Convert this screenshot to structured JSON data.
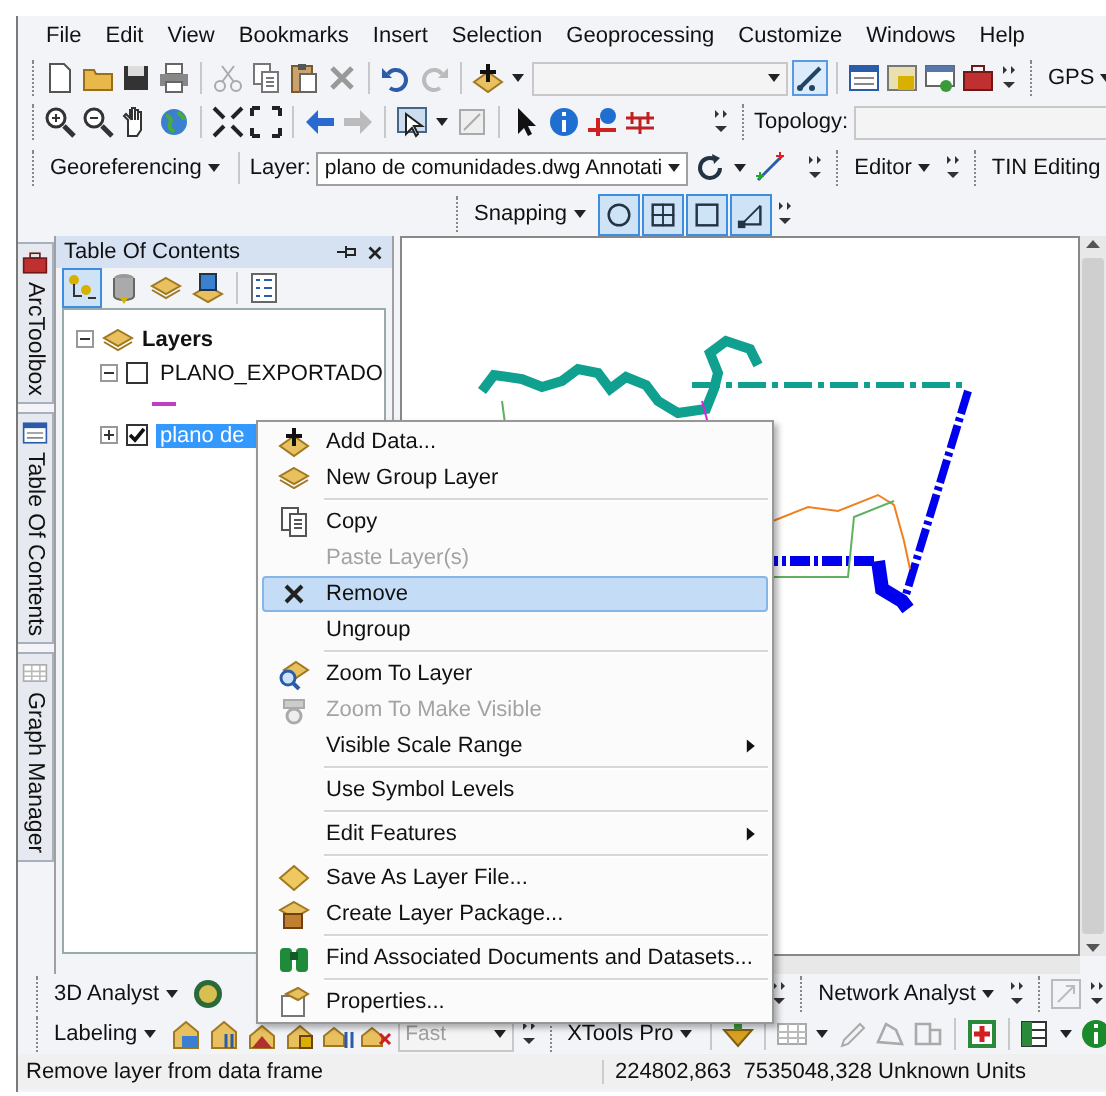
{
  "menu_bar": [
    "File",
    "Edit",
    "View",
    "Bookmarks",
    "Insert",
    "Selection",
    "Geoprocessing",
    "Customize",
    "Windows",
    "Help"
  ],
  "standard_toolbar": {
    "gps_menu": "GPS"
  },
  "tools_toolbar": {
    "topology_label": "Topology:"
  },
  "georeferencing_toolbar": {
    "menu": "Georeferencing",
    "layer_label": "Layer:",
    "layer_value": "plano de comunidades.dwg Annotati"
  },
  "editor_toolbar": {
    "menu": "Editor"
  },
  "tin_toolbar": {
    "menu": "TIN Editing"
  },
  "snapping_toolbar": {
    "menu": "Snapping",
    "buttons": [
      {
        "on": true
      },
      {
        "on": true
      },
      {
        "on": true
      },
      {
        "on": true
      }
    ]
  },
  "side_tabs": [
    "ArcToolbox",
    "Table Of Contents",
    "Graph Manager"
  ],
  "toc": {
    "title": "Table Of Contents",
    "view_buttons": [
      {
        "selected": true
      },
      {
        "selected": false
      },
      {
        "selected": false
      },
      {
        "selected": false
      }
    ],
    "data_frame": {
      "label": "Layers",
      "expanded": true,
      "children": [
        {
          "label": "PLANO_EXPORTADO",
          "checked": false,
          "expanded": true,
          "selected": false
        },
        {
          "label": "plano de",
          "checked": true,
          "expanded": false,
          "selected": true
        }
      ]
    }
  },
  "context_menu": [
    {
      "kind": "item",
      "label": "Add Data...",
      "disabled": false,
      "selected": false,
      "submenu": false
    },
    {
      "kind": "item",
      "label": "New Group Layer",
      "disabled": false,
      "selected": false,
      "submenu": false
    },
    {
      "kind": "separator"
    },
    {
      "kind": "item",
      "label": "Copy",
      "disabled": false,
      "selected": false,
      "submenu": false
    },
    {
      "kind": "item",
      "label": "Paste Layer(s)",
      "disabled": true,
      "selected": false,
      "submenu": false
    },
    {
      "kind": "item",
      "label": "Remove",
      "disabled": false,
      "selected": true,
      "submenu": false
    },
    {
      "kind": "item",
      "label": "Ungroup",
      "disabled": false,
      "selected": false,
      "submenu": false
    },
    {
      "kind": "separator"
    },
    {
      "kind": "item",
      "label": "Zoom To Layer",
      "disabled": false,
      "selected": false,
      "submenu": false
    },
    {
      "kind": "item",
      "label": "Zoom To Make Visible",
      "disabled": true,
      "selected": false,
      "submenu": false
    },
    {
      "kind": "item",
      "label": "Visible Scale Range",
      "disabled": false,
      "selected": false,
      "submenu": true
    },
    {
      "kind": "separator"
    },
    {
      "kind": "item",
      "label": "Use Symbol Levels",
      "disabled": false,
      "selected": false,
      "submenu": false
    },
    {
      "kind": "separator"
    },
    {
      "kind": "item",
      "label": "Edit Features",
      "disabled": false,
      "selected": false,
      "submenu": true
    },
    {
      "kind": "separator"
    },
    {
      "kind": "item",
      "label": "Save As Layer File...",
      "disabled": false,
      "selected": false,
      "submenu": false
    },
    {
      "kind": "item",
      "label": "Create Layer Package...",
      "disabled": false,
      "selected": false,
      "submenu": false
    },
    {
      "kind": "separator"
    },
    {
      "kind": "item",
      "label": "Find Associated Documents and Datasets...",
      "disabled": false,
      "selected": false,
      "submenu": false
    },
    {
      "kind": "separator"
    },
    {
      "kind": "item",
      "label": "Properties...",
      "disabled": false,
      "selected": false,
      "submenu": false
    }
  ],
  "analyst_toolbar": {
    "menu": "3D Analyst"
  },
  "network_toolbar": {
    "menu": "Network Analyst"
  },
  "labeling_toolbar": {
    "menu": "Labeling",
    "quality": {
      "value": "Fast",
      "disabled": true
    }
  },
  "xtools_toolbar": {
    "menu": "XTools Pro"
  },
  "status_bar": {
    "message": "Remove layer from data frame",
    "coordinates": "224802,863  7535048,328 Unknown Units"
  }
}
